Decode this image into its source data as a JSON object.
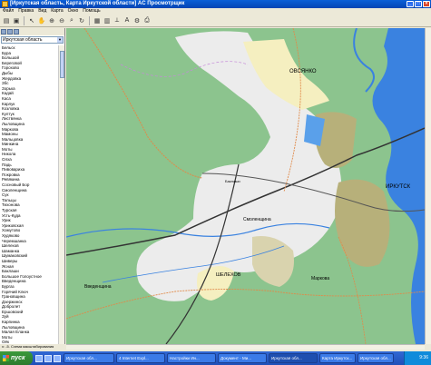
{
  "window": {
    "title": "[Иркутская область, Карта Иркутской области] AC Просмотрщик",
    "buttons": [
      "_",
      "□",
      "×"
    ]
  },
  "menu": [
    "Файл",
    "Правка",
    "Вид",
    "Карта",
    "Окно",
    "Помощь"
  ],
  "layers_panel": {
    "selected": "Иркутская область",
    "items": [
      "Бельск",
      "Бура",
      "Большой",
      "Береговой",
      "Горохово",
      "Дыбы",
      "Жердовка",
      "Збс",
      "Зорька",
      "Кадай",
      "Каса",
      "Карлук",
      "Козловка",
      "Култук",
      "Листвянка",
      "Лыловщина",
      "Маркова",
      "Мамоны",
      "Мальцовка",
      "Минкина",
      "Моты",
      "Никола",
      "Олха",
      "Падь",
      "Пивовариха",
      "Покровка",
      "Ревякина",
      "Сосновый Бор",
      "Смоленщина",
      "Сук",
      "Тальцы",
      "Тихонова",
      "Турская",
      "Усть-Куда",
      "Урик",
      "Уриковская",
      "Хомутово",
      "Худяково",
      "Черемшанка",
      "Шелехов",
      "Шаманка",
      "Шумаковский",
      "Шиверы",
      "Ясная",
      "Баклаши",
      "Большое Голоустное",
      "Введенщина",
      "Бургаз",
      "Горячий Ключ",
      "Грановщина",
      "Дзержинск",
      "Добролет",
      "Ершовский",
      "Зуй",
      "Карпинка",
      "Лыловщина",
      "Малая Еланка",
      "Моты",
      "Оёк",
      "Плишкина",
      "Пономарева",
      "Старый Кутулик",
      "Тайтурка",
      "Тельма"
    ]
  },
  "map": {
    "labels": {
      "ovsyanko": "ОВСЯНКО",
      "irkutsk": "ИРКУТСК",
      "smolenshina": "Смоленщина",
      "shelekhov": "ШЕЛЕХОВ",
      "vvedenshina": "Введенщина",
      "markova": "Маркова",
      "baklashi": "Баклаши"
    },
    "colors": {
      "forest": "#8cc48e",
      "urban": "#ececec",
      "city_core": "#f5efc0",
      "water": "#3a82e0",
      "rail": "#333333",
      "road": "#e08a4a",
      "hills": "#b7b07a"
    }
  },
  "statusbar": {
    "text": "x: -5. Схема масштабирования"
  },
  "taskbar": {
    "start_label": "пуск",
    "tasks": [
      "Иркутская обл...",
      "4 Internet Expl...",
      "Настройки Ин...",
      "Документ - Ми...",
      "Иркутская обл...",
      "Карта Иркутск...",
      "Иркутская обл..."
    ],
    "clock": "9:36"
  }
}
